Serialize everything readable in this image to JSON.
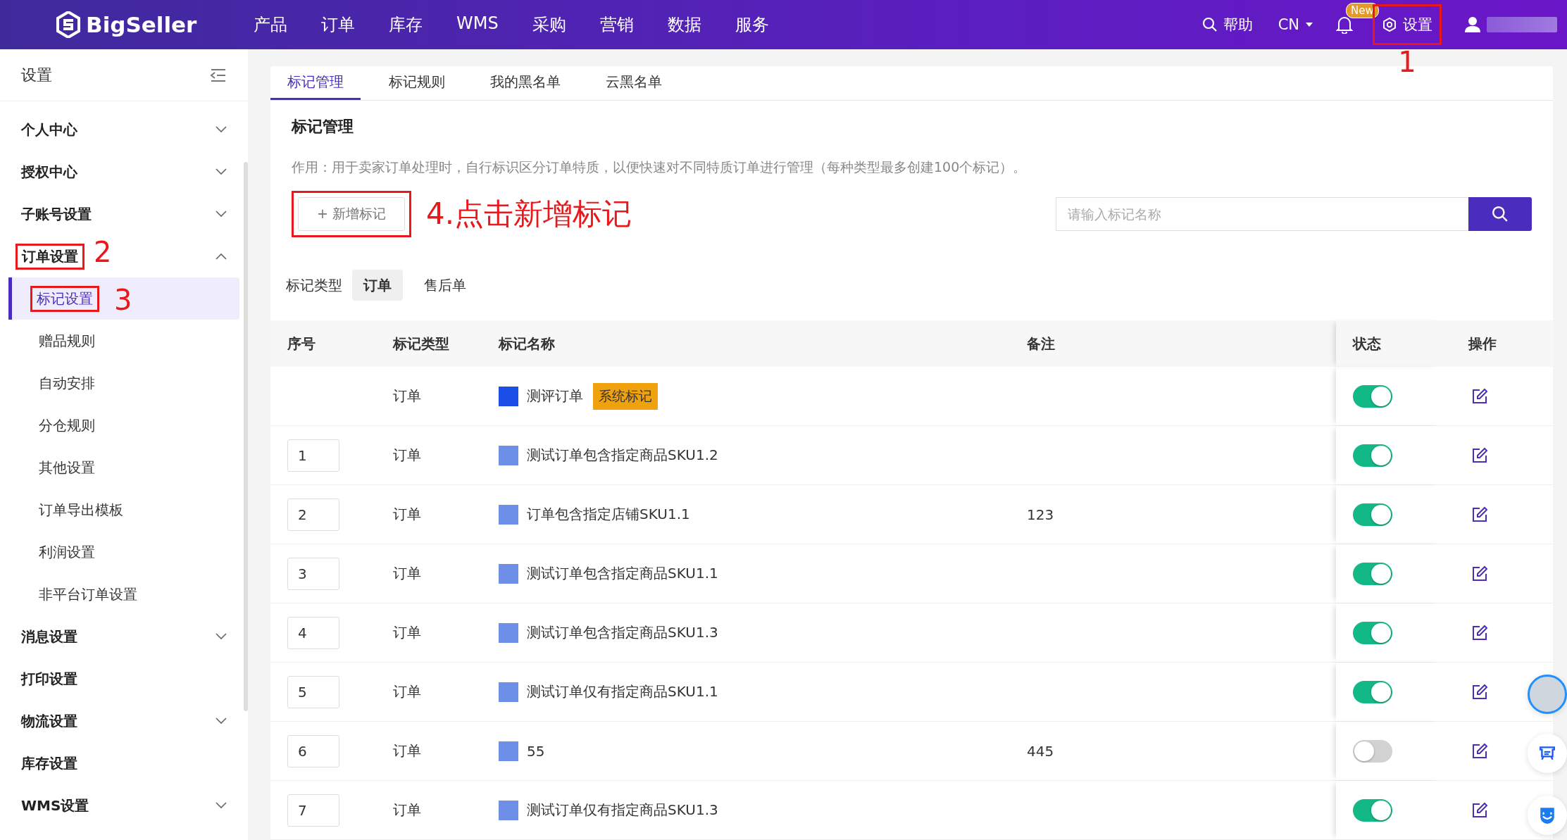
{
  "header": {
    "logo": "BigSeller",
    "nav": [
      {
        "label": "产品"
      },
      {
        "label": "订单"
      },
      {
        "label": "库存"
      },
      {
        "label": "WMS"
      },
      {
        "label": "采购"
      },
      {
        "label": "营销"
      },
      {
        "label": "数据"
      },
      {
        "label": "服务"
      }
    ],
    "help": "帮助",
    "language": "CN",
    "badge": "New",
    "settings": {
      "label": "设置",
      "callout": "1"
    }
  },
  "sidebar": {
    "title": "设置",
    "items": [
      {
        "label": "个人中心",
        "kind": "group",
        "expanded": false
      },
      {
        "label": "授权中心",
        "kind": "group",
        "expanded": false
      },
      {
        "label": "子账号设置",
        "kind": "group",
        "expanded": false
      },
      {
        "label": "订单设置",
        "kind": "group",
        "expanded": true,
        "callout": "2",
        "children": [
          {
            "label": "标记设置",
            "selected": true,
            "callout": "3"
          },
          {
            "label": "赠品规则",
            "selected": false
          },
          {
            "label": "自动安排",
            "selected": false
          },
          {
            "label": "分仓规则",
            "selected": false
          },
          {
            "label": "其他设置",
            "selected": false
          },
          {
            "label": "订单导出模板",
            "selected": false
          },
          {
            "label": "利润设置",
            "selected": false
          },
          {
            "label": "非平台订单设置",
            "selected": false
          }
        ]
      },
      {
        "label": "消息设置",
        "kind": "group",
        "expanded": false
      },
      {
        "label": "打印设置",
        "kind": "link"
      },
      {
        "label": "物流设置",
        "kind": "group",
        "expanded": false
      },
      {
        "label": "库存设置",
        "kind": "link"
      },
      {
        "label": "WMS设置",
        "kind": "group",
        "expanded": false
      }
    ]
  },
  "tabs": [
    {
      "label": "标记管理",
      "selected": true
    },
    {
      "label": "标记规则",
      "selected": false
    },
    {
      "label": "我的黑名单",
      "selected": false
    },
    {
      "label": "云黑名单",
      "selected": false
    }
  ],
  "section": {
    "title": "标记管理",
    "description": "作用：用于卖家订单处理时，自行标识区分订单特质，以便快速对不同特质订单进行管理（每种类型最多创建100个标记）。",
    "add_button": "+ 新增标记",
    "add_callout": "4.点击新增标记",
    "search": {
      "placeholder": "请输入标记名称"
    }
  },
  "type_filter": {
    "label": "标记类型",
    "options": [
      {
        "label": "订单",
        "selected": true
      },
      {
        "label": "售后单",
        "selected": false
      }
    ]
  },
  "table": {
    "columns": [
      "序号",
      "标记类型",
      "标记名称",
      "备注",
      "状态",
      "操作"
    ],
    "rows": [
      {
        "index": "",
        "type": "订单",
        "name": "测评订单",
        "color": "#1a4ee6",
        "tag": "系统标记",
        "note": "",
        "on": true
      },
      {
        "index": "1",
        "type": "订单",
        "name": "测试订单包含指定商品SKU1.2",
        "color": "#6e8fe8",
        "note": "",
        "on": true
      },
      {
        "index": "2",
        "type": "订单",
        "name": "订单包含指定店铺SKU1.1",
        "color": "#6e8fe8",
        "note": "123",
        "on": true
      },
      {
        "index": "3",
        "type": "订单",
        "name": "测试订单包含指定商品SKU1.1",
        "color": "#6e8fe8",
        "note": "",
        "on": true
      },
      {
        "index": "4",
        "type": "订单",
        "name": "测试订单包含指定商品SKU1.3",
        "color": "#6e8fe8",
        "note": "",
        "on": true
      },
      {
        "index": "5",
        "type": "订单",
        "name": "测试订单仅有指定商品SKU1.1",
        "color": "#6e8fe8",
        "note": "",
        "on": true
      },
      {
        "index": "6",
        "type": "订单",
        "name": "55",
        "color": "#6e8fe8",
        "note": "445",
        "on": false
      },
      {
        "index": "7",
        "type": "订单",
        "name": "测试订单仅有指定商品SKU1.3",
        "color": "#6e8fe8",
        "note": "",
        "on": true
      }
    ]
  }
}
